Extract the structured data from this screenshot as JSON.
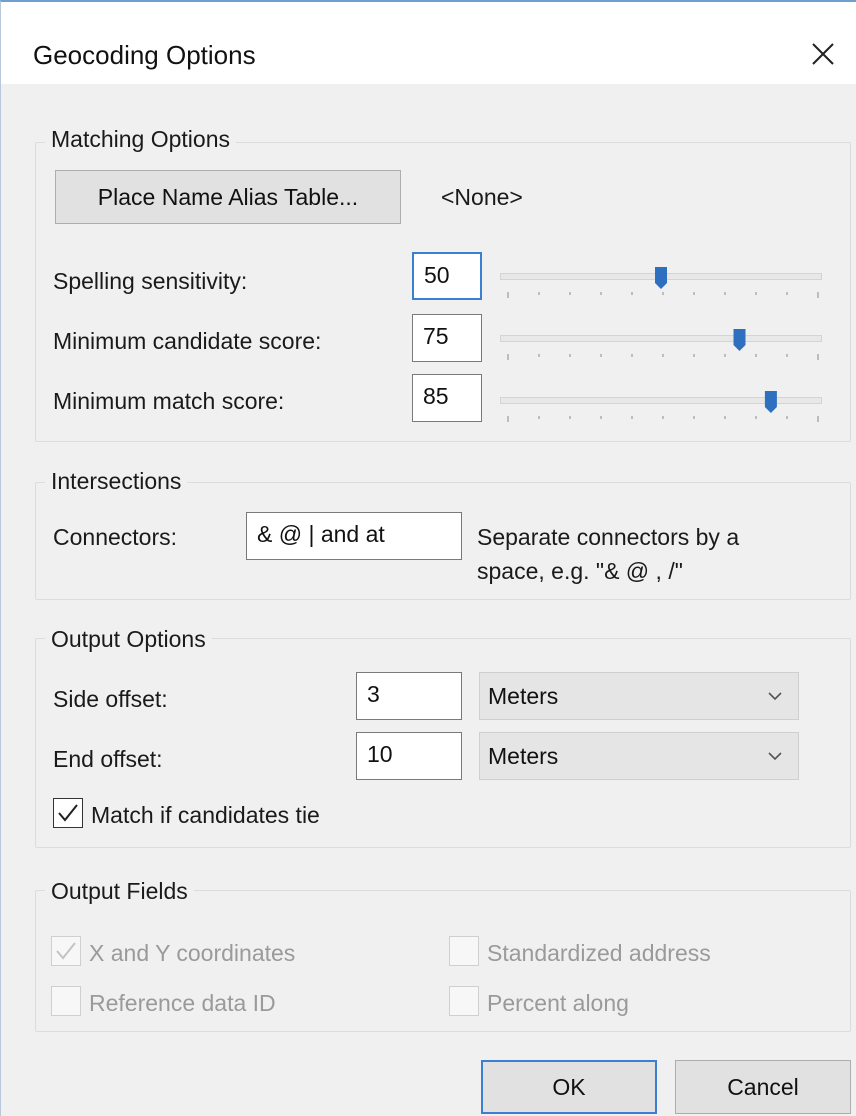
{
  "dialog": {
    "title": "Geocoding Options",
    "close_icon": "close-icon"
  },
  "matching": {
    "group_title": "Matching Options",
    "alias_button": "Place Name Alias Table...",
    "alias_value": "<None>",
    "sliders": [
      {
        "label": "Spelling sensitivity:",
        "value": "50",
        "level": 0.5
      },
      {
        "label": "Minimum candidate score:",
        "value": "75",
        "level": 0.75
      },
      {
        "label": "Minimum match score:",
        "value": "85",
        "level": 0.85
      }
    ]
  },
  "intersections": {
    "group_title": "Intersections",
    "connectors_label": "Connectors:",
    "connectors_value": "& @ | and at",
    "hint_line1": "Separate connectors by a",
    "hint_line2": "space, e.g. \"& @ , /\""
  },
  "output_options": {
    "group_title": "Output Options",
    "side_offset_label": "Side offset:",
    "side_offset_value": "3",
    "side_offset_unit": "Meters",
    "end_offset_label": "End offset:",
    "end_offset_value": "10",
    "end_offset_unit": "Meters",
    "tie_label": "Match if candidates tie",
    "tie_checked": true
  },
  "output_fields": {
    "group_title": "Output Fields",
    "xy_label": "X and Y coordinates",
    "xy_checked": true,
    "std_address_label": "Standardized address",
    "ref_id_label": "Reference data ID",
    "percent_along_label": "Percent along"
  },
  "buttons": {
    "ok": "OK",
    "cancel": "Cancel"
  },
  "colors": {
    "accent": "#3b7fd0",
    "thumb": "#2f6fbf"
  }
}
